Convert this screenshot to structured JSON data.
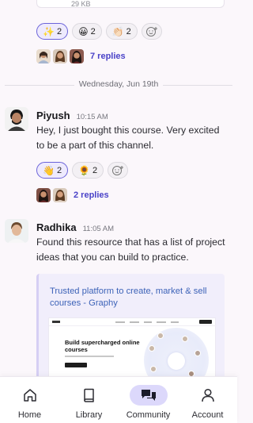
{
  "top_message": {
    "file_size": "29 KB",
    "reactions": [
      {
        "emoji": "✨",
        "count": "2",
        "active": true
      },
      {
        "emoji": "😀",
        "count": "2",
        "active": false
      },
      {
        "emoji": "👏🏻",
        "count": "2",
        "active": false
      }
    ],
    "replies_label": "7 replies"
  },
  "date_divider": "Wednesday, Jun 19th",
  "messages": [
    {
      "author": "Piyush",
      "time": "10:15 AM",
      "text": "Hey, I just bought this course. Very excited to be a part of this channel.",
      "reactions": [
        {
          "emoji": "👋",
          "count": "2",
          "active": true
        },
        {
          "emoji": "🌻",
          "count": "2",
          "active": false
        }
      ],
      "replies_label": "2 replies"
    },
    {
      "author": "Radhika",
      "time": "11:05 AM",
      "text": "Found this resource that has a list of project ideas that you can build to practice.",
      "link_preview": {
        "title": "Trusted platform to create, market & sell courses - Graphy",
        "headline": "Build supercharged online courses"
      }
    }
  ],
  "bottom_nav": {
    "items": [
      {
        "label": "Home",
        "icon": "home-icon",
        "active": false
      },
      {
        "label": "Library",
        "icon": "book-icon",
        "active": false
      },
      {
        "label": "Community",
        "icon": "chat-bubbles-icon",
        "active": true
      },
      {
        "label": "Account",
        "icon": "person-icon",
        "active": false
      }
    ]
  },
  "colors": {
    "accent": "#4a43c8",
    "active_chip_border": "#6b63d9",
    "active_nav_bg": "#dcd8fb",
    "link": "#3d63b8",
    "background": "#fbf7fb"
  }
}
